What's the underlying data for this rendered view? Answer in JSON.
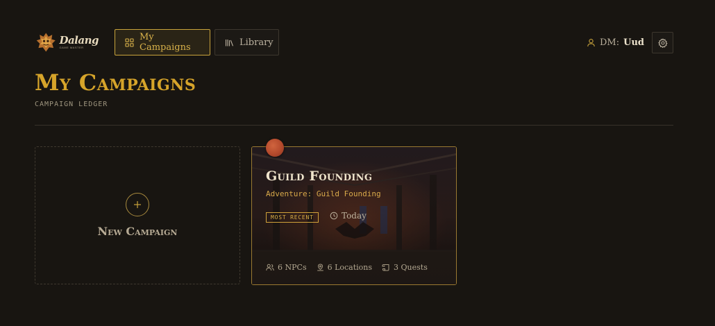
{
  "app": {
    "logo_word": "Dalang",
    "logo_sub": "GAME MASTER"
  },
  "nav": {
    "campaigns_label": "My Campaigns",
    "library_label": "Library"
  },
  "user": {
    "dm_label": "DM:",
    "dm_name": "Uud"
  },
  "page": {
    "title": "My Campaigns",
    "subtitle": "CAMPAIGN LEDGER"
  },
  "new_campaign": {
    "label": "New Campaign"
  },
  "campaigns": [
    {
      "title": "Guild Founding",
      "subtitle": "Adventure: Guild Founding",
      "badge": "MOST RECENT",
      "last_played": "Today",
      "npcs": "6 NPCs",
      "locations": "6 Locations",
      "quests": "3 Quests"
    }
  ],
  "colors": {
    "background": "#181511",
    "accent_gold": "#d6a42a",
    "pin_red": "#b44a2c"
  },
  "icons": {
    "campaigns": "grid-icon",
    "library": "books-icon",
    "user": "user-icon",
    "settings": "gear-icon",
    "new": "plus-icon",
    "time": "clock-icon",
    "npcs": "people-icon",
    "locations": "location-icon",
    "quests": "scroll-icon"
  }
}
